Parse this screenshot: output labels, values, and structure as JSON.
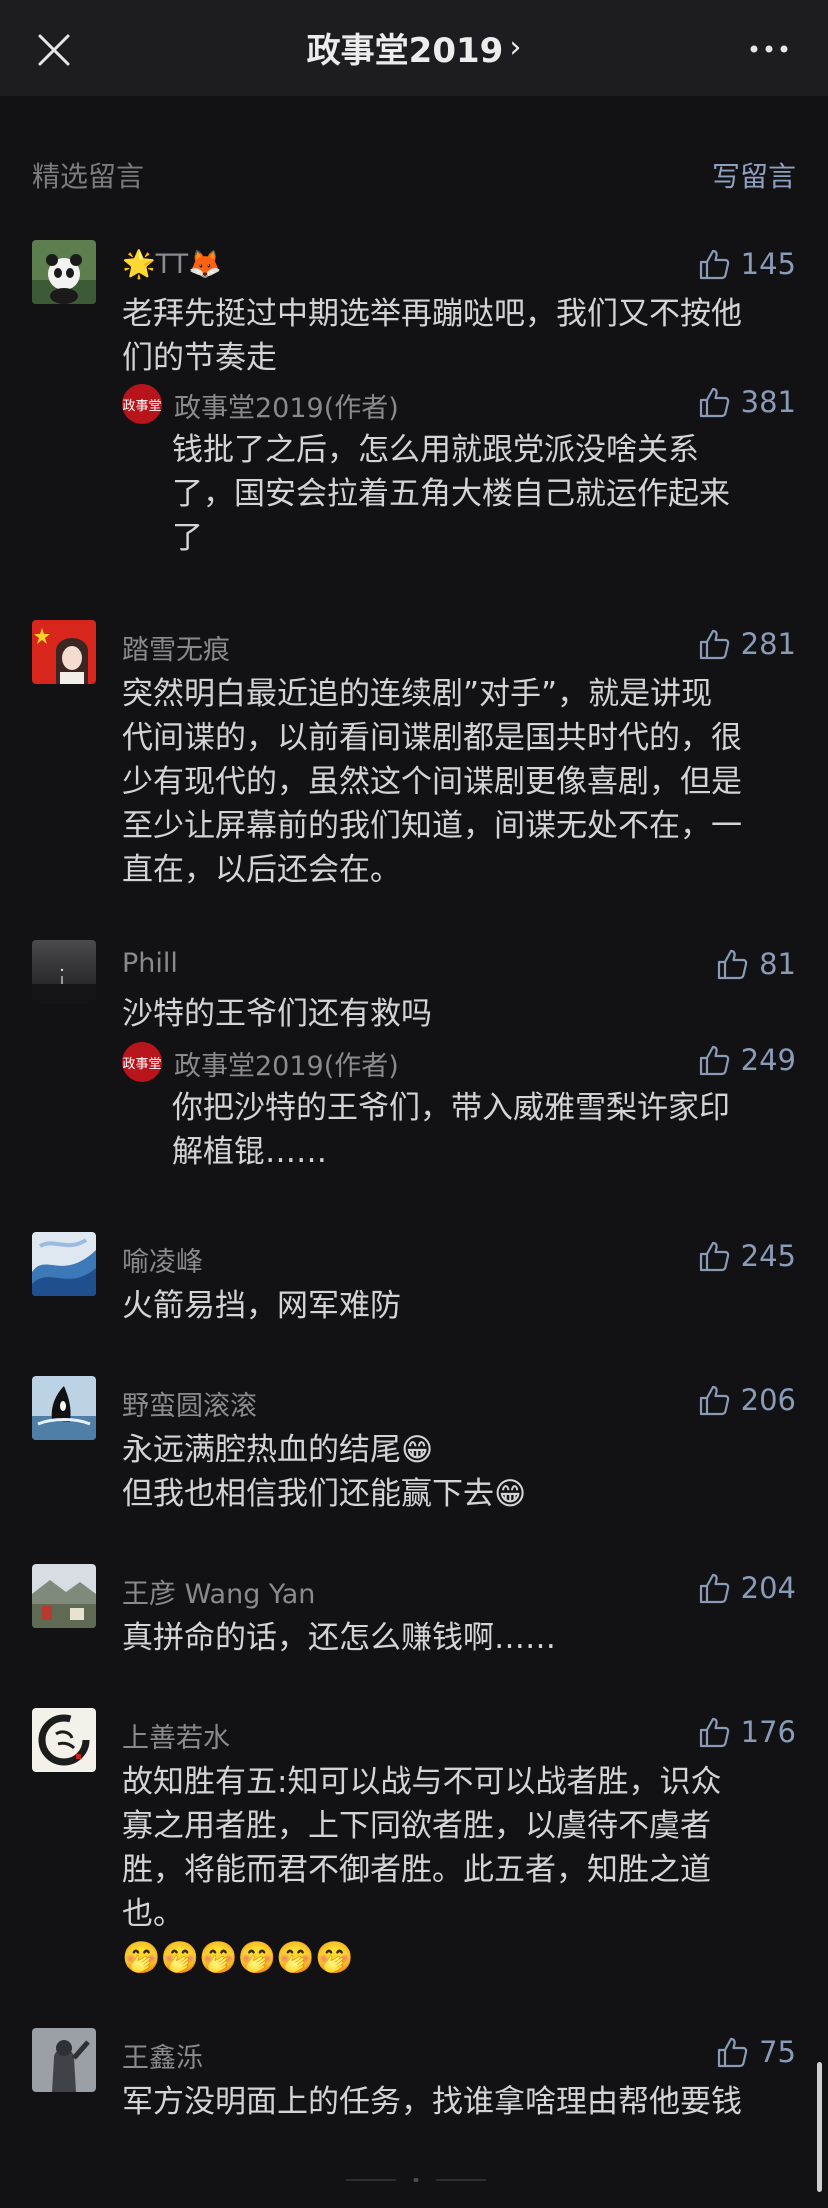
{
  "header": {
    "title": "政事堂2019",
    "chevron": "›"
  },
  "section": {
    "title": "精选留言",
    "write_label": "写留言"
  },
  "comments": [
    {
      "name": "🌟TT🦊",
      "likes": "145",
      "text": "老拜先挺过中期选举再蹦哒吧，我们又不按他\n们的节奏走",
      "avatar_icon": "panda-avatar-icon",
      "reply": {
        "name": "政事堂2019(作者)",
        "likes": "381",
        "avatar_text": "政事堂",
        "text": "钱批了之后，怎么用就跟党派没啥关系\n了，国安会拉着五角大楼自己就运作起来\n了"
      }
    },
    {
      "name": "踏雪无痕",
      "likes": "281",
      "text": "突然明白最近追的连续剧”对手”，就是讲现\n代间谍的，以前看间谍剧都是国共时代的，很\n少有现代的，虽然这个间谍剧更像喜剧，但是\n至少让屏幕前的我们知道，间谍无处不在，一\n直在，以后还会在。",
      "avatar_icon": "flag-portrait-avatar-icon"
    },
    {
      "name": "Phill",
      "likes": "81",
      "text": "沙特的王爷们还有救吗",
      "avatar_icon": "night-sky-avatar-icon",
      "reply": {
        "name": "政事堂2019(作者)",
        "likes": "249",
        "avatar_text": "政事堂",
        "text": "你把沙特的王爷们，带入威雅雪梨许家印\n解植锟……"
      }
    },
    {
      "name": "喻凌峰",
      "likes": "245",
      "text": "火箭易挡，网军难防",
      "avatar_icon": "blue-wave-avatar-icon"
    },
    {
      "name": "野蛮圆滚滚",
      "likes": "206",
      "text": "永远满腔热血的结尾😁\n但我也相信我们还能赢下去😁",
      "avatar_icon": "orca-avatar-icon"
    },
    {
      "name": "王彦 Wang Yan",
      "likes": "204",
      "text": "真拼命的话，还怎么赚钱啊……",
      "avatar_icon": "landscape-avatar-icon"
    },
    {
      "name": "上善若水",
      "likes": "176",
      "text": "故知胜有五:知可以战与不可以战者胜，识众\n寡之用者胜，上下同欲者胜，以虞待不虞者\n胜，将能而君不御者胜。此五者，知胜之道\n也。\n🤭🤭🤭🤭🤭🤭",
      "avatar_icon": "ink-calligraphy-avatar-icon"
    },
    {
      "name": "王鑫泺",
      "likes": "75",
      "text": "军方没明面上的任务，找谁拿啥理由帮他要钱",
      "avatar_icon": "statue-avatar-icon"
    }
  ],
  "colors": {
    "background": "#121114",
    "header": "#1d1c20",
    "link": "#8fa0bf",
    "reply_avatar": "#b8141c"
  }
}
